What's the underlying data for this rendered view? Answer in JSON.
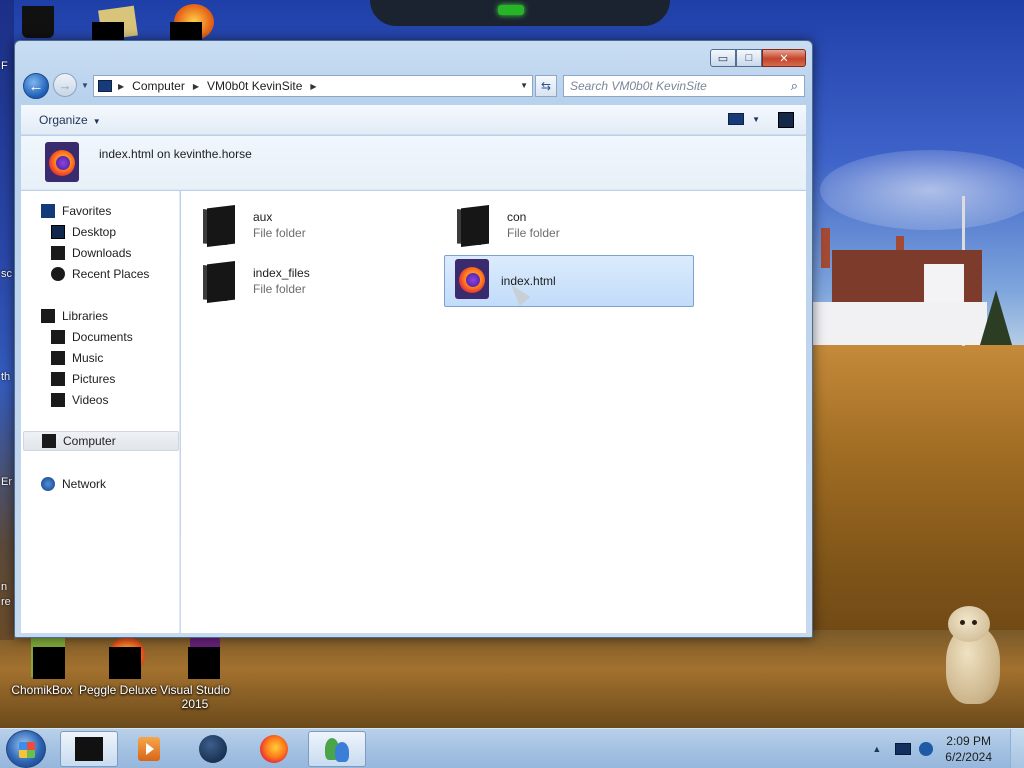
{
  "window": {
    "caption_buttons": {
      "minimize": "▭",
      "maximize": "□",
      "close": "✕"
    },
    "address": {
      "crumbs": [
        "Computer",
        "VM0b0t KevinSite"
      ],
      "search_placeholder": "Search VM0b0t KevinSite"
    },
    "toolbar": {
      "organize_label": "Organize"
    },
    "header": {
      "title": "index.html on kevinthe.horse"
    },
    "nav": {
      "favorites": {
        "label": "Favorites",
        "items": [
          "Desktop",
          "Downloads",
          "Recent Places"
        ]
      },
      "libraries": {
        "label": "Libraries",
        "items": [
          "Documents",
          "Music",
          "Pictures",
          "Videos"
        ]
      },
      "computer": "Computer",
      "network": "Network"
    },
    "files": [
      {
        "name": "aux",
        "type": "File folder"
      },
      {
        "name": "con",
        "type": "File folder"
      },
      {
        "name": "index_files",
        "type": "File folder"
      },
      {
        "name": "index.html",
        "type": ""
      }
    ]
  },
  "desktop": {
    "icons": [
      {
        "label": "ChomikBox"
      },
      {
        "label": "Peggle Deluxe"
      },
      {
        "label": "Visual Studio 2015"
      }
    ],
    "left_strip_text": [
      "F",
      "sc",
      "th",
      "Er",
      "n",
      "re"
    ]
  },
  "taskbar": {
    "clock_time": "2:09 PM",
    "clock_date": "6/2/2024"
  },
  "colors": {
    "accent": "#1c5db6",
    "selection": "#c1dcfa",
    "taskbar": "#a4c2e3"
  }
}
